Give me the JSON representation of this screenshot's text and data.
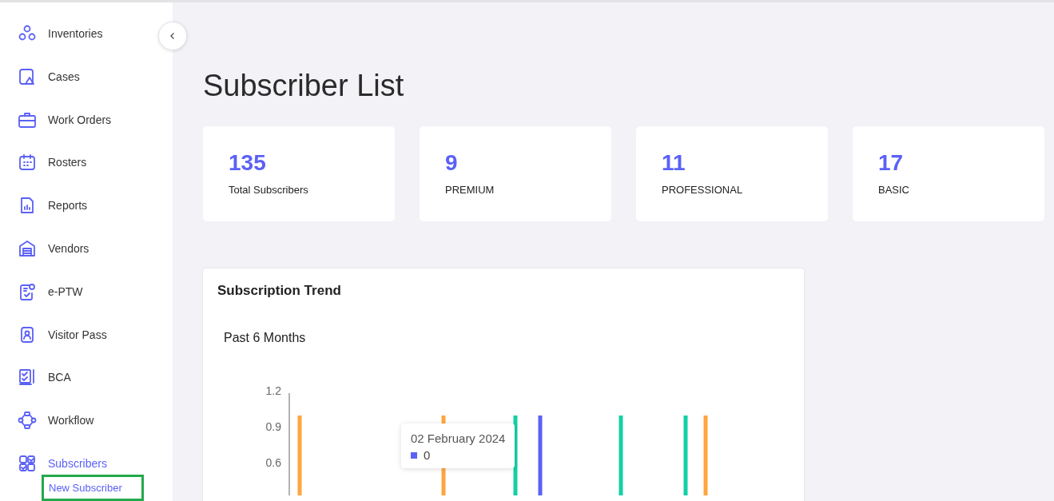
{
  "sidebar": {
    "items": [
      {
        "label": "Inventories",
        "selected": false
      },
      {
        "label": "Cases",
        "selected": false
      },
      {
        "label": "Work Orders",
        "selected": false
      },
      {
        "label": "Rosters",
        "selected": false
      },
      {
        "label": "Reports",
        "selected": false
      },
      {
        "label": "Vendors",
        "selected": false
      },
      {
        "label": "e-PTW",
        "selected": false
      },
      {
        "label": "Visitor Pass",
        "selected": false
      },
      {
        "label": "BCA",
        "selected": false
      },
      {
        "label": "Workflow",
        "selected": false
      },
      {
        "label": "Subscribers",
        "selected": true,
        "children": [
          {
            "label": "New Subscriber",
            "selected": true
          }
        ]
      }
    ]
  },
  "page": {
    "title": "Subscriber List"
  },
  "stats": [
    {
      "value": "135",
      "label": "Total Subscribers"
    },
    {
      "value": "9",
      "label": "PREMIUM"
    },
    {
      "value": "11",
      "label": "PROFESSIONAL"
    },
    {
      "value": "17",
      "label": "BASIC"
    }
  ],
  "trend": {
    "title": "Subscription Trend",
    "subtitle": "Past 6 Months",
    "y_axis_labels": [
      "1.2",
      "0.9",
      "0.6"
    ],
    "tooltip": {
      "date": "02 February 2024",
      "color": "#5b61f5",
      "value": "0"
    }
  }
}
